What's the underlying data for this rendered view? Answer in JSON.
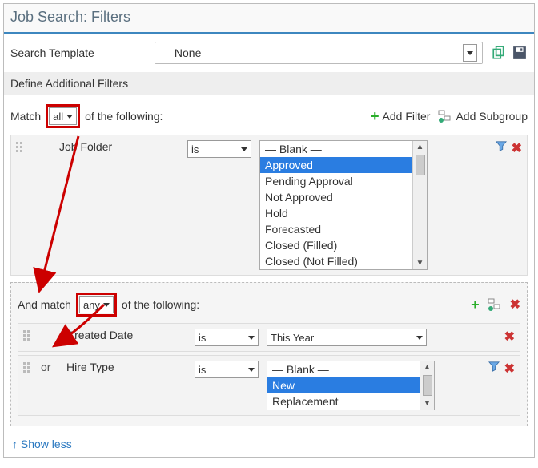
{
  "page_title": "Job Search: Filters",
  "search_template": {
    "label": "Search Template",
    "value": "— None —"
  },
  "section_title": "Define Additional Filters",
  "main_group": {
    "match_prefix": "Match",
    "match_mode": "all",
    "match_suffix": "of the following:",
    "add_filter_label": "Add Filter",
    "add_subgroup_label": "Add Subgroup"
  },
  "filter_job_folder": {
    "field": "Job Folder",
    "operator": "is",
    "options": [
      "— Blank —",
      "Approved",
      "Pending Approval",
      "Not Approved",
      "Hold",
      "Forecasted",
      "Closed (Filled)",
      "Closed (Not Filled)"
    ],
    "selected_index": 1
  },
  "subgroup": {
    "prefix": "And match",
    "mode": "any",
    "suffix": "of the following:"
  },
  "filter_created_date": {
    "conj": "",
    "field": "Created Date",
    "operator": "is",
    "value": "This Year"
  },
  "filter_hire_type": {
    "conj": "or",
    "field": "Hire Type",
    "operator": "is",
    "options": [
      "— Blank —",
      "New",
      "Replacement"
    ],
    "selected_index": 1
  },
  "footer": {
    "show_less": "Show less"
  }
}
